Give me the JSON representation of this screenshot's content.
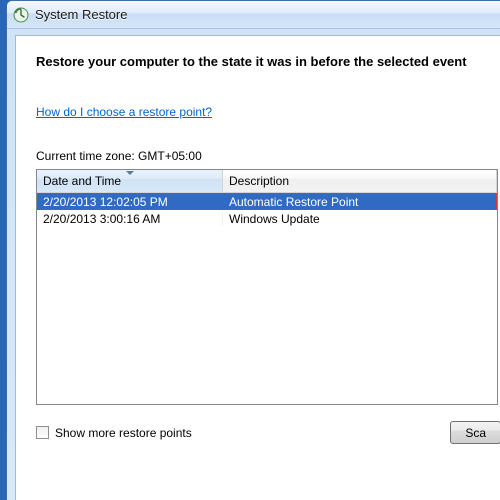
{
  "window": {
    "title": "System Restore"
  },
  "page": {
    "heading": "Restore your computer to the state it was in before the selected event",
    "help_link": "How do I choose a restore point?",
    "timezone_label": "Current time zone: GMT+05:00"
  },
  "table": {
    "columns": {
      "date": "Date and Time",
      "desc": "Description"
    },
    "rows": [
      {
        "date": "2/20/2013 12:02:05 PM",
        "desc": "Automatic Restore Point",
        "selected": true
      },
      {
        "date": "2/20/2013 3:00:16 AM",
        "desc": "Windows Update",
        "selected": false
      }
    ]
  },
  "footer": {
    "show_more_label": "Show more restore points",
    "scan_button": "Sca"
  }
}
